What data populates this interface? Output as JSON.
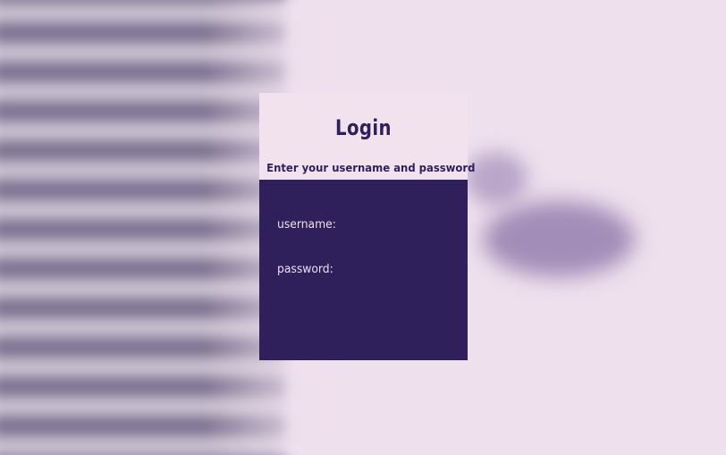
{
  "login": {
    "title": "Login",
    "subtitle": "Enter your username and password",
    "username_label": "username:",
    "password_label": "password:"
  },
  "colors": {
    "page_background": "#efe0ee",
    "header_background": "#f1e2ee",
    "panel_background": "#2f205c",
    "title_text": "#2f1f5c",
    "label_text": "#e9e1ef"
  }
}
